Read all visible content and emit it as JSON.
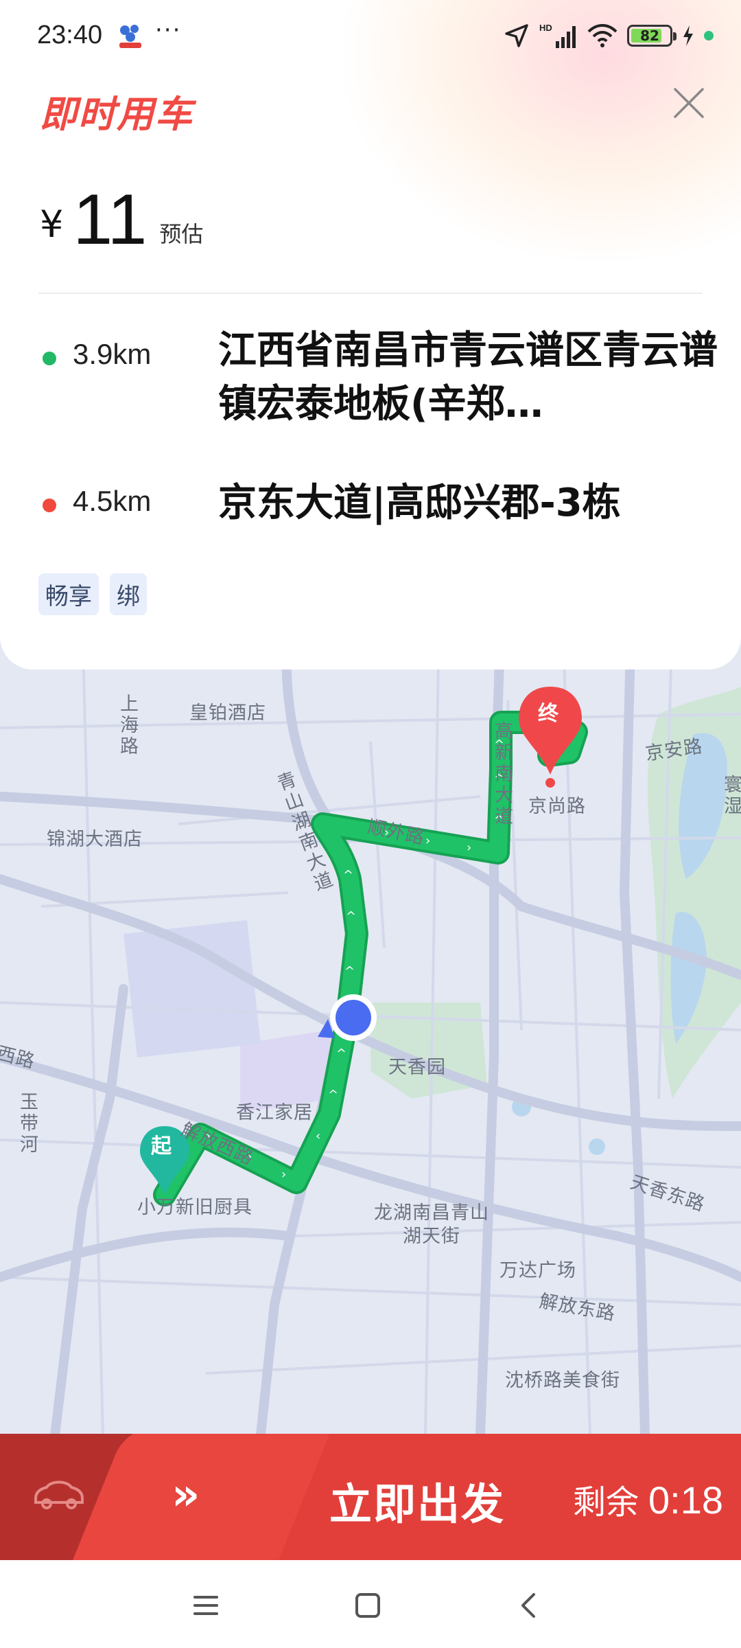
{
  "status_bar": {
    "time": "23:40",
    "more": "···",
    "battery": "82",
    "icons": [
      "location-arrow-icon",
      "hd-signal-icon",
      "wifi-icon",
      "battery-icon",
      "charging-icon"
    ]
  },
  "header": {
    "title": "即时用车",
    "close_icon": "close-icon"
  },
  "fare": {
    "currency": "¥",
    "amount": "11",
    "label": "预估"
  },
  "trip": {
    "pickup": {
      "distance": "3.9km",
      "address": "江西省南昌市青云谱区青云谱镇宏泰地板(辛郑…",
      "dot_color": "#22b866"
    },
    "dropoff": {
      "distance": "4.5km",
      "address": "京东大道|高邸兴郡-3栋",
      "dot_color": "#ef4a3d"
    }
  },
  "tags": [
    "畅享",
    "绑"
  ],
  "map": {
    "labels": {
      "huangbo": "皇铂酒店",
      "shanghai_rd": "上海路",
      "jinhu": "锦湖大酒店",
      "qingshanhu": "青山湖南大道",
      "shunwai": "顺外路",
      "gaoxin": "高新南大道",
      "jingshang": "京尚路",
      "jingan": "京安路",
      "huanshi": "寰湿",
      "tianxiangyuan": "天香园",
      "xiangjiang": "香江家居",
      "jiefang_w": "解放西路",
      "xiaowan": "小万新旧厨具",
      "longhu": "龙湖南昌青山湖天街",
      "wanda": "万达广场",
      "jiefang_e": "解放东路",
      "tianxiang_e": "天香东路",
      "shenqiao": "沈桥路美食街",
      "xilu": "西路",
      "yudaihe": "玉带河"
    },
    "start_marker": "起",
    "end_marker": "终",
    "route_color": "#1db860"
  },
  "action": {
    "car_icon": "car-icon",
    "chevrons": "»",
    "go_label": "立即出发",
    "remain_label": "剩余",
    "remain_time": "0:18"
  },
  "navbar": [
    "menu-icon",
    "home-icon",
    "back-icon"
  ]
}
